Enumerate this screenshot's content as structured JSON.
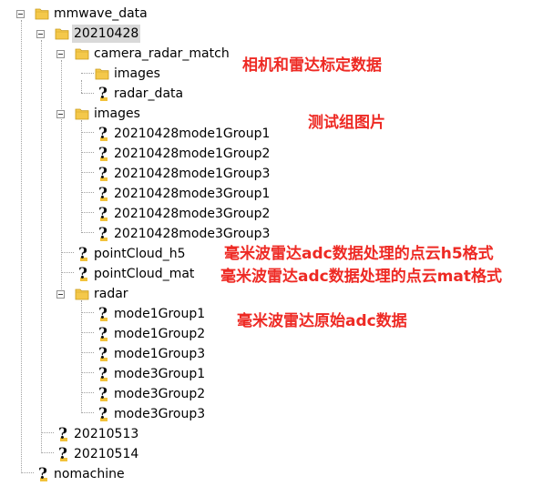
{
  "tree": {
    "nodes": [
      {
        "id": "mmwave_data",
        "label": "mmwave_data",
        "icon": "folder-icon",
        "expanded": true
      },
      {
        "id": "20210428",
        "label": "20210428",
        "icon": "folder-icon",
        "expanded": true,
        "selected": true
      },
      {
        "id": "camera_radar_match",
        "label": "camera_radar_match",
        "icon": "folder-icon",
        "expanded": true
      },
      {
        "id": "camera_radar_match_images",
        "label": "images",
        "icon": "folder-icon"
      },
      {
        "id": "radar_data",
        "label": "radar_data",
        "icon": "unknown-icon"
      },
      {
        "id": "images",
        "label": "images",
        "icon": "folder-icon",
        "expanded": true
      },
      {
        "id": "img_m1g1",
        "label": "20210428mode1Group1",
        "icon": "unknown-icon"
      },
      {
        "id": "img_m1g2",
        "label": "20210428mode1Group2",
        "icon": "unknown-icon"
      },
      {
        "id": "img_m1g3",
        "label": "20210428mode1Group3",
        "icon": "unknown-icon"
      },
      {
        "id": "img_m3g1",
        "label": "20210428mode3Group1",
        "icon": "unknown-icon"
      },
      {
        "id": "img_m3g2",
        "label": "20210428mode3Group2",
        "icon": "unknown-icon"
      },
      {
        "id": "img_m3g3",
        "label": "20210428mode3Group3",
        "icon": "unknown-icon"
      },
      {
        "id": "pointCloud_h5",
        "label": "pointCloud_h5",
        "icon": "unknown-icon"
      },
      {
        "id": "pointCloud_mat",
        "label": "pointCloud_mat",
        "icon": "unknown-icon"
      },
      {
        "id": "radar",
        "label": "radar",
        "icon": "folder-icon",
        "expanded": true
      },
      {
        "id": "radar_m1g1",
        "label": "mode1Group1",
        "icon": "unknown-icon"
      },
      {
        "id": "radar_m1g2",
        "label": "mode1Group2",
        "icon": "unknown-icon"
      },
      {
        "id": "radar_m1g3",
        "label": "mode1Group3",
        "icon": "unknown-icon"
      },
      {
        "id": "radar_m3g1",
        "label": "mode3Group1",
        "icon": "unknown-icon"
      },
      {
        "id": "radar_m3g2",
        "label": "mode3Group2",
        "icon": "unknown-icon"
      },
      {
        "id": "radar_m3g3",
        "label": "mode3Group3",
        "icon": "unknown-icon"
      },
      {
        "id": "20210513",
        "label": "20210513",
        "icon": "unknown-icon"
      },
      {
        "id": "20210514",
        "label": "20210514",
        "icon": "unknown-icon"
      },
      {
        "id": "nomachine",
        "label": "nomachine",
        "icon": "unknown-icon"
      }
    ]
  },
  "annotations": {
    "camera_radar": "相机和雷达标定数据",
    "images": "测试组图片",
    "pointcloud_h5": "毫米波雷达adc数据处理的点云h5格式",
    "pointcloud_mat": "毫米波雷达adc数据处理的点云mat格式",
    "radar": "毫米波雷达原始adc数据"
  },
  "colors": {
    "annotation": "#ee2a24",
    "folder": "#f4c84a",
    "selection": "#d9d9d9",
    "tree_lines": "#a0a0a0"
  }
}
